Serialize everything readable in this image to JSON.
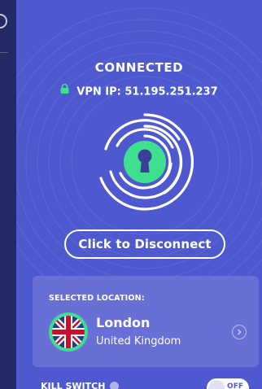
{
  "status": {
    "title": "CONNECTED",
    "ip_label": "VPN IP: 51.195.251.237"
  },
  "actions": {
    "disconnect_label": "Click to Disconnect"
  },
  "location": {
    "label": "SELECTED LOCATION:",
    "city": "London",
    "country": "United Kingdom"
  },
  "kill_switch": {
    "label": "KILL SWITCH",
    "state": "OFF"
  },
  "icons": {
    "lock": "lock-icon",
    "fingerprint": "fingerprint-icon",
    "flag": "uk-flag-icon",
    "chevron": "chevron-right-icon",
    "info": "info-icon"
  },
  "colors": {
    "background": "#4f59cf",
    "sidebar": "#222a67",
    "accent": "#3ee08f",
    "card": "#6870d6"
  }
}
